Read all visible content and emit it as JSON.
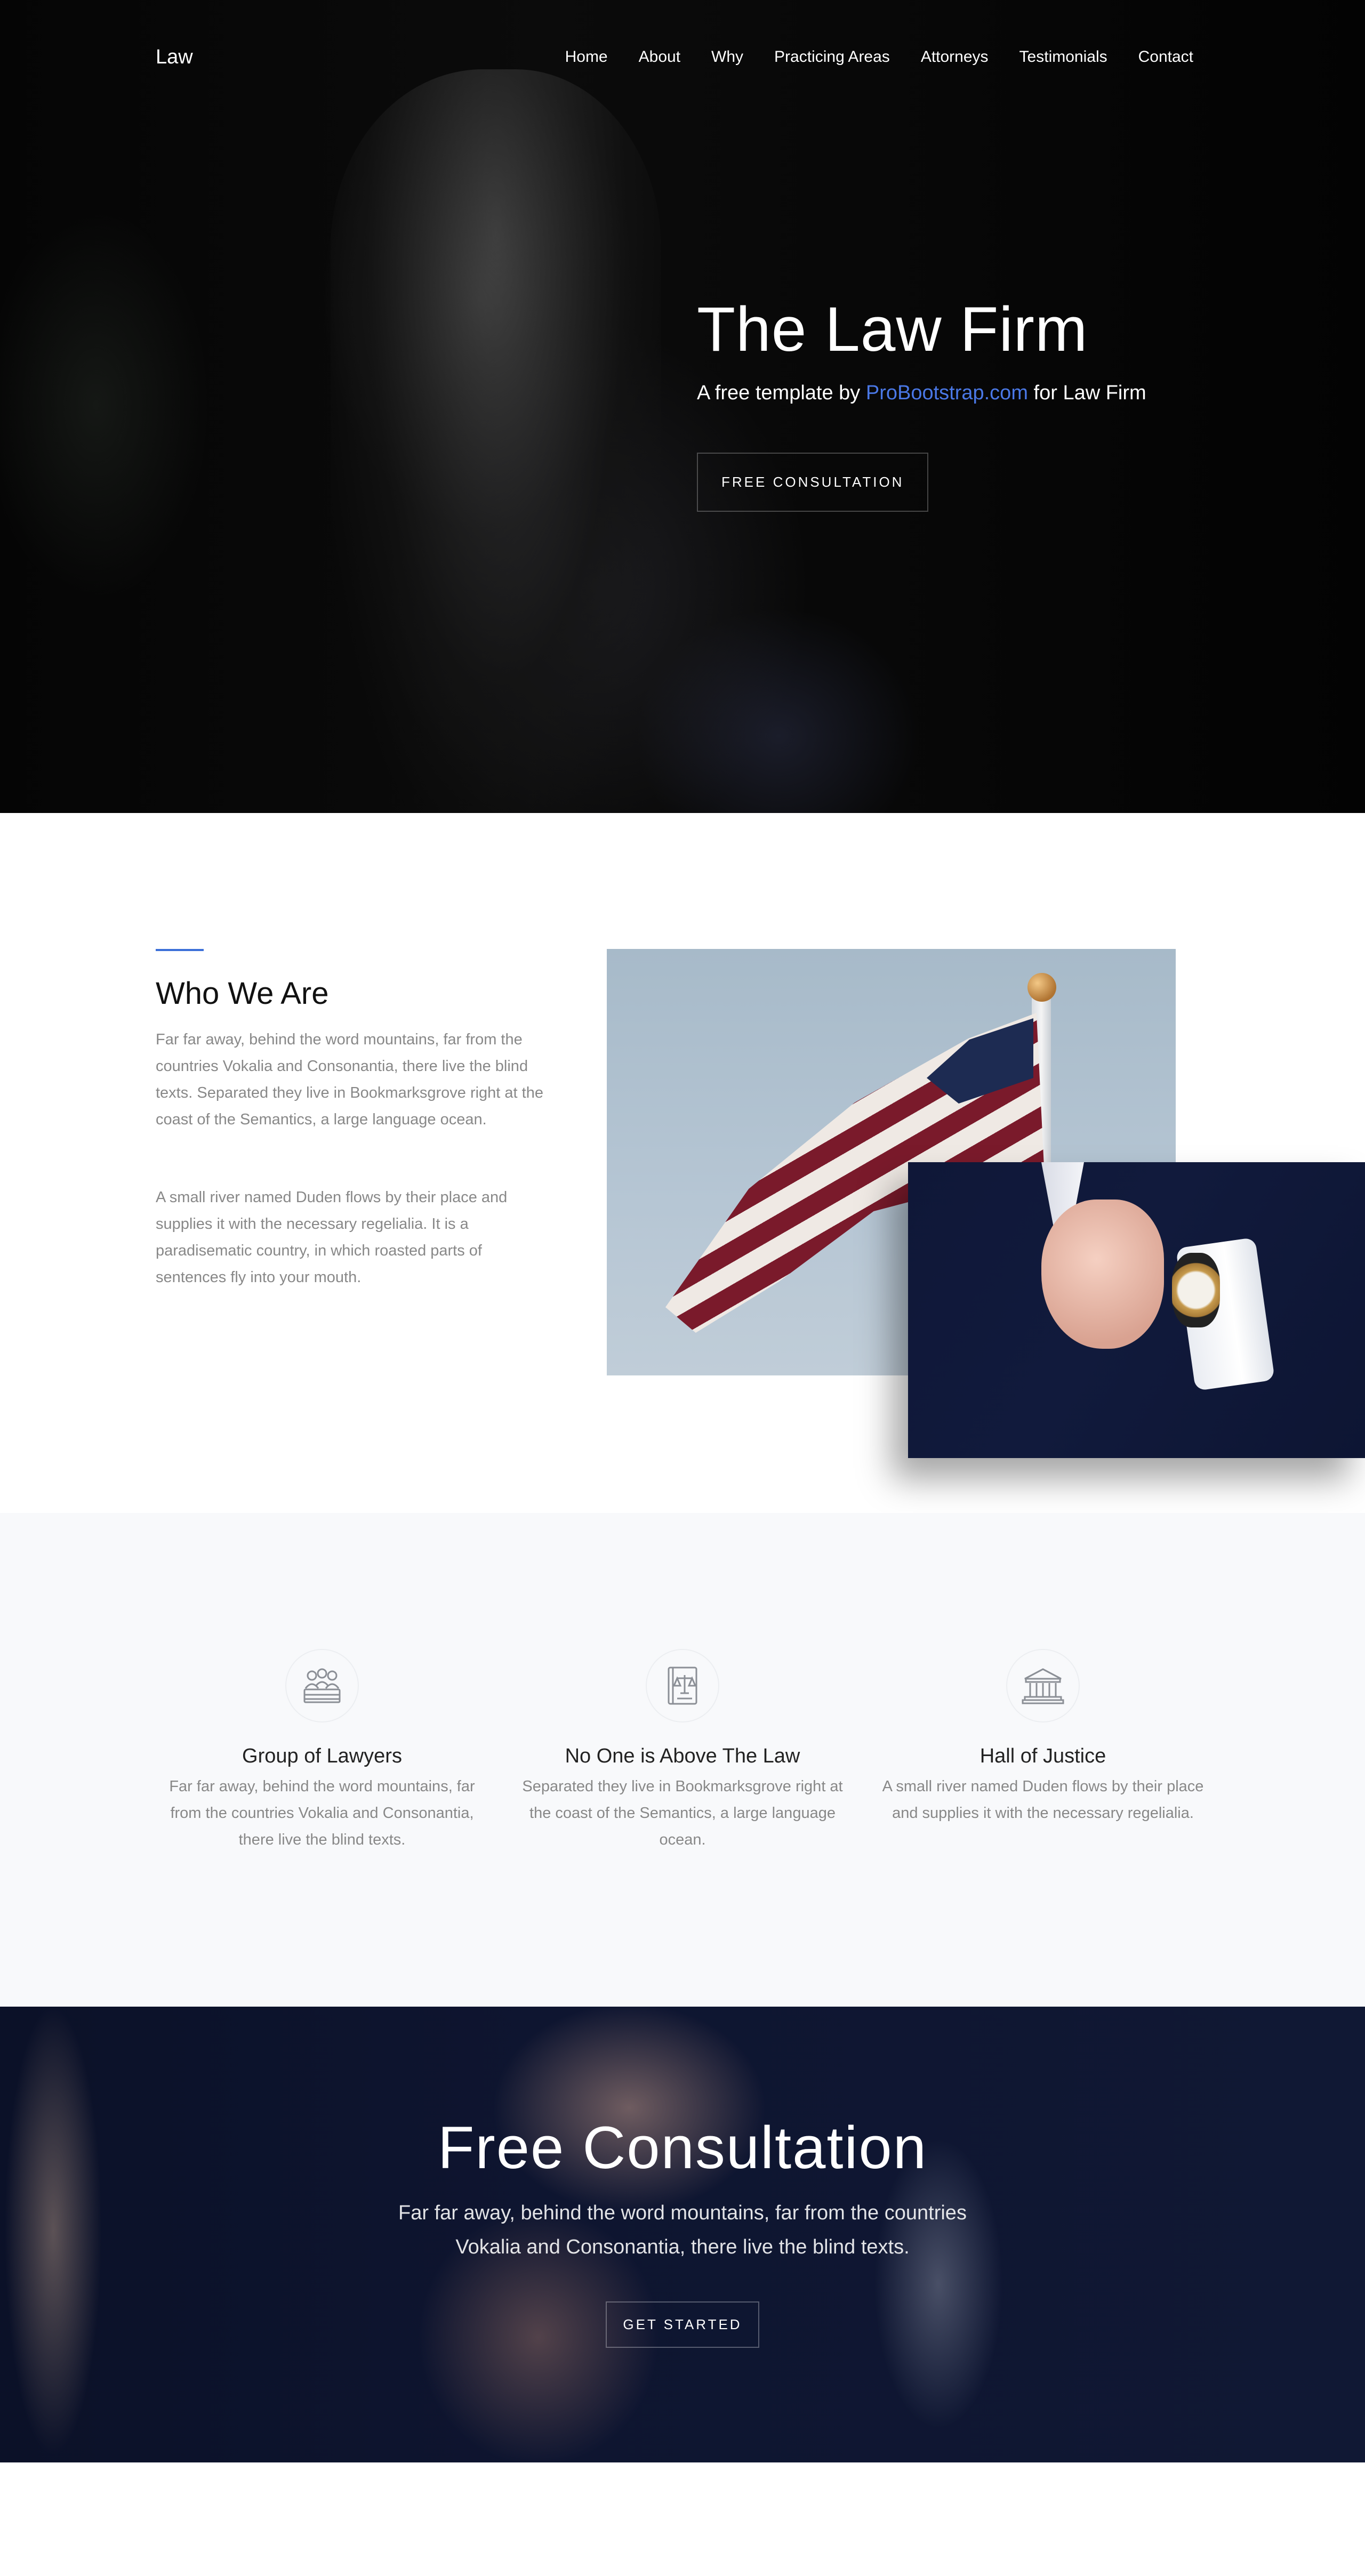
{
  "nav": {
    "brand": "Law",
    "items": [
      {
        "label": "Home"
      },
      {
        "label": "About"
      },
      {
        "label": "Why"
      },
      {
        "label": "Practicing Areas"
      },
      {
        "label": "Attorneys"
      },
      {
        "label": "Testimonials"
      },
      {
        "label": "Contact"
      }
    ]
  },
  "hero": {
    "title": "The Law Firm",
    "subtitle_prefix": "A free template by ",
    "subtitle_link": "ProBootstrap.com",
    "subtitle_suffix": " for Law Firm",
    "button": "FREE CONSULTATION"
  },
  "about": {
    "title": "Who We Are",
    "paragraph1": "Far far away, behind the word mountains, far from the countries Vokalia and Consonantia, there live the blind texts. Separated they live in Bookmarksgrove right at the coast of the Semantics, a large language ocean.",
    "paragraph2": "A small river named Duden flows by their place and supplies it with the necessary regelialia. It is a paradisematic country, in which roasted parts of sentences fly into your mouth."
  },
  "features": [
    {
      "icon": "group-of-lawyers-icon",
      "title": "Group of Lawyers",
      "text": "Far far away, behind the word mountains, far from the countries Vokalia and Consonantia, there live the blind texts."
    },
    {
      "icon": "law-book-icon",
      "title": "No One is Above The Law",
      "text": "Separated they live in Bookmarksgrove right at the coast of the Semantics, a large language ocean."
    },
    {
      "icon": "courthouse-icon",
      "title": "Hall of Justice",
      "text": "A small river named Duden flows by their place and supplies it with the necessary regelialia."
    }
  ],
  "consultation": {
    "title": "Free Consultation",
    "text": "Far far away, behind the word mountains, far from the countries Vokalia and Consonantia, there live the blind texts.",
    "button": "GET STARTED"
  },
  "colors": {
    "accent": "#3b6fd8",
    "link": "#4a78e6",
    "muted_text": "#888888",
    "features_bg": "#f8f9fb"
  }
}
